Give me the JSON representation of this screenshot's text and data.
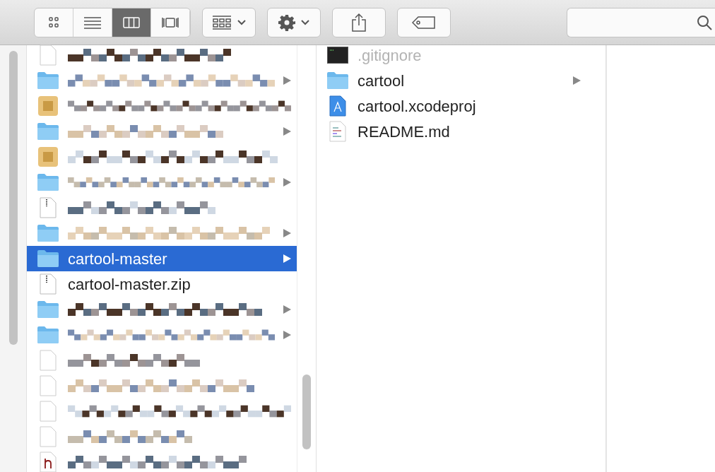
{
  "toolbar": {
    "view_modes": [
      {
        "kind": "icons",
        "selected": false
      },
      {
        "kind": "list",
        "selected": false
      },
      {
        "kind": "columns",
        "selected": true
      },
      {
        "kind": "gallery",
        "selected": false
      }
    ],
    "buttons": [
      {
        "kind": "arrange",
        "menu": true
      },
      {
        "kind": "action",
        "menu": true
      },
      {
        "kind": "share",
        "menu": false
      },
      {
        "kind": "tags",
        "menu": false
      }
    ]
  },
  "column_1": {
    "rows": [
      {
        "kind": "document",
        "expandable": false,
        "selected": false
      },
      {
        "kind": "folder",
        "expandable": true,
        "selected": false
      },
      {
        "kind": "app",
        "expandable": false,
        "selected": false
      },
      {
        "kind": "folder",
        "expandable": true,
        "selected": false
      },
      {
        "kind": "app",
        "expandable": false,
        "selected": false
      },
      {
        "kind": "folder",
        "expandable": true,
        "selected": false
      },
      {
        "kind": "zip",
        "expandable": false,
        "selected": false
      },
      {
        "kind": "folder",
        "expandable": true,
        "selected": false
      },
      {
        "kind": "folder",
        "name": "cartool-master",
        "expandable": true,
        "selected": true
      },
      {
        "kind": "zip",
        "name": "cartool-master.zip",
        "expandable": false,
        "selected": false
      },
      {
        "kind": "folder",
        "expandable": true,
        "selected": false
      },
      {
        "kind": "folder",
        "expandable": true,
        "selected": false
      },
      {
        "kind": "document",
        "expandable": false,
        "selected": false
      },
      {
        "kind": "document",
        "expandable": false,
        "selected": false
      },
      {
        "kind": "document",
        "expandable": false,
        "selected": false
      },
      {
        "kind": "document",
        "expandable": false,
        "selected": false
      },
      {
        "kind": "header",
        "expandable": false,
        "selected": false
      }
    ]
  },
  "column_2": {
    "rows": [
      {
        "kind": "terminal",
        "name": ".gitignore",
        "hidden": true,
        "expandable": false,
        "selected": false
      },
      {
        "kind": "folder",
        "name": "cartool",
        "hidden": false,
        "expandable": true,
        "selected": false
      },
      {
        "kind": "xcodeproj",
        "name": "cartool.xcodeproj",
        "hidden": false,
        "expandable": false,
        "selected": false
      },
      {
        "kind": "text",
        "name": "README.md",
        "hidden": false,
        "expandable": false,
        "selected": false
      }
    ]
  }
}
